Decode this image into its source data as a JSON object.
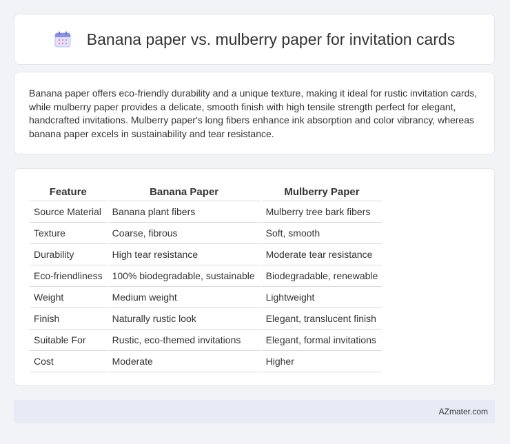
{
  "header": {
    "title": "Banana paper vs. mulberry paper for invitation cards",
    "icon": "calendar-icon"
  },
  "summary": {
    "text": "Banana paper offers eco-friendly durability and a unique texture, making it ideal for rustic invitation cards, while mulberry paper provides a delicate, smooth finish with high tensile strength perfect for elegant, handcrafted invitations. Mulberry paper's long fibers enhance ink absorption and color vibrancy, whereas banana paper excels in sustainability and tear resistance."
  },
  "table": {
    "headers": [
      "Feature",
      "Banana Paper",
      "Mulberry Paper"
    ],
    "rows": [
      [
        "Source Material",
        "Banana plant fibers",
        "Mulberry tree bark fibers"
      ],
      [
        "Texture",
        "Coarse, fibrous",
        "Soft, smooth"
      ],
      [
        "Durability",
        "High tear resistance",
        "Moderate tear resistance"
      ],
      [
        "Eco-friendliness",
        "100% biodegradable, sustainable",
        "Biodegradable, renewable"
      ],
      [
        "Weight",
        "Medium weight",
        "Lightweight"
      ],
      [
        "Finish",
        "Naturally rustic look",
        "Elegant, translucent finish"
      ],
      [
        "Suitable For",
        "Rustic, eco-themed invitations",
        "Elegant, formal invitations"
      ],
      [
        "Cost",
        "Moderate",
        "Higher"
      ]
    ]
  },
  "footer": {
    "brand": "AZmater.com"
  },
  "colors": {
    "page_background": "#f1f3f6",
    "footer_background": "#e6ebf5",
    "icon_accent": "#8b8fe8"
  }
}
